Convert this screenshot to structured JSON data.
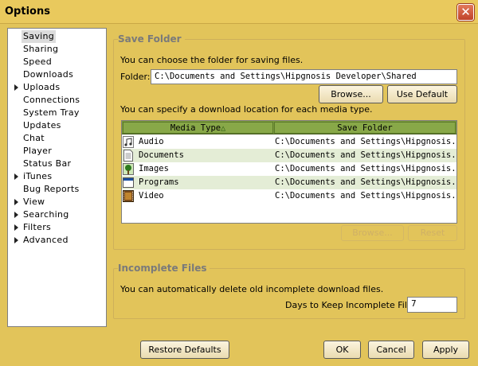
{
  "window": {
    "title": "Options",
    "close_glyph": "✕"
  },
  "nav": {
    "items": [
      {
        "label": "Saving",
        "expandable": false,
        "selected": true
      },
      {
        "label": "Sharing",
        "expandable": false
      },
      {
        "label": "Speed",
        "expandable": false
      },
      {
        "label": "Downloads",
        "expandable": false
      },
      {
        "label": "Uploads",
        "expandable": true
      },
      {
        "label": "Connections",
        "expandable": false
      },
      {
        "label": "System Tray",
        "expandable": false
      },
      {
        "label": "Updates",
        "expandable": false
      },
      {
        "label": "Chat",
        "expandable": false
      },
      {
        "label": "Player",
        "expandable": false
      },
      {
        "label": "Status Bar",
        "expandable": false
      },
      {
        "label": "iTunes",
        "expandable": true
      },
      {
        "label": "Bug Reports",
        "expandable": false
      },
      {
        "label": "View",
        "expandable": true
      },
      {
        "label": "Searching",
        "expandable": true
      },
      {
        "label": "Filters",
        "expandable": true
      },
      {
        "label": "Advanced",
        "expandable": true
      }
    ]
  },
  "save_folder": {
    "title": "Save Folder",
    "intro": "You can choose the folder for saving files.",
    "folder_label": "Folder:",
    "folder_value": "C:\\Documents and Settings\\Hipgnosis Developer\\Shared",
    "browse_label": "Browse...",
    "use_default_label": "Use Default",
    "media_intro": "You can specify a download location for each media type.",
    "table": {
      "columns": [
        "Media Type",
        "Save Folder"
      ],
      "sort_indicator": "△",
      "rows": [
        {
          "type": "Audio",
          "icon": "audio-icon",
          "folder": "C:\\Documents and Settings\\Hipgnosis..."
        },
        {
          "type": "Documents",
          "icon": "document-icon",
          "folder": "C:\\Documents and Settings\\Hipgnosis..."
        },
        {
          "type": "Images",
          "icon": "image-icon",
          "folder": "C:\\Documents and Settings\\Hipgnosis..."
        },
        {
          "type": "Programs",
          "icon": "program-icon",
          "folder": "C:\\Documents and Settings\\Hipgnosis..."
        },
        {
          "type": "Video",
          "icon": "video-icon",
          "folder": "C:\\Documents and Settings\\Hipgnosis..."
        }
      ]
    },
    "row_browse_label": "Browse...",
    "row_reset_label": "Reset"
  },
  "incomplete": {
    "title": "Incomplete Files",
    "intro": "You can automatically delete old incomplete download files.",
    "days_label": "Days to Keep Incomplete Files:",
    "days_value": "7"
  },
  "footer": {
    "restore_label": "Restore Defaults",
    "ok_label": "OK",
    "cancel_label": "Cancel",
    "apply_label": "Apply"
  },
  "colors": {
    "background": "#e2c45a",
    "table_header": "#88a848",
    "row_alt": "#e4edd6",
    "close_button": "#c0432a"
  }
}
